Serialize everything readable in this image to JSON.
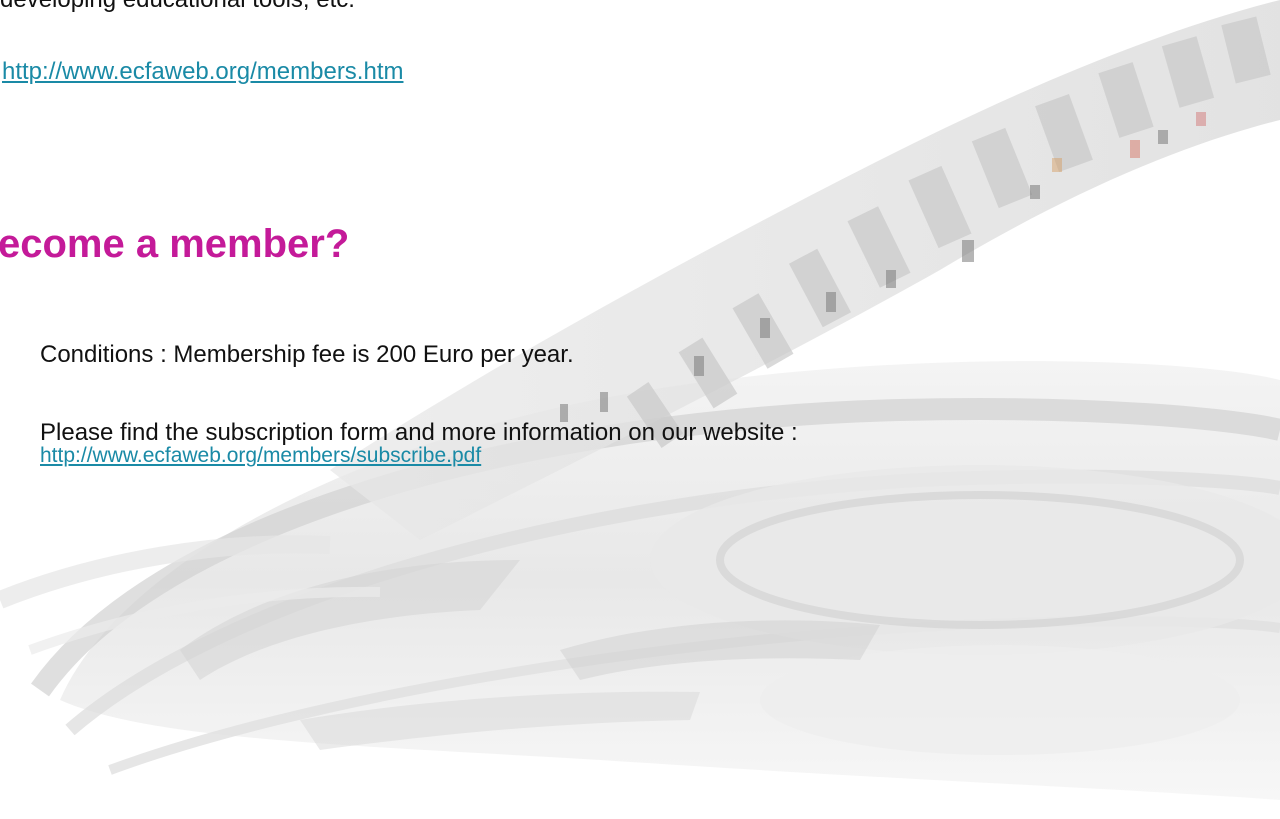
{
  "intro": {
    "text": "developing educational tools, etc."
  },
  "members_link": {
    "text": "http://www.ecfaweb.org/members.htm"
  },
  "heading": {
    "text": "ecome a member?"
  },
  "conditions": {
    "text": "Conditions : Membership fee is 200 Euro per year."
  },
  "subscribe": {
    "text": "Please find the subscription  form and more information on our website :",
    "link_text": "http://www.ecfaweb.org/members/subscribe.pdf"
  },
  "colors": {
    "heading": "#c41a99",
    "link": "#1a8aa6",
    "body_text": "#111111"
  },
  "background": {
    "icon": "film-reel-watermark"
  }
}
